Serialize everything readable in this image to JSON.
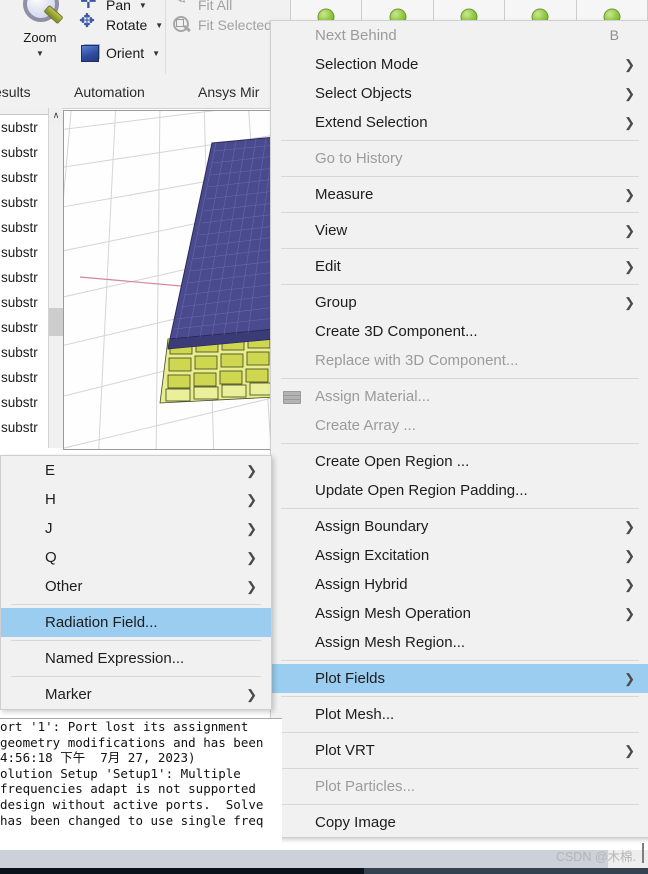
{
  "app": {
    "toolbar": {
      "zoom_label": "Zoom",
      "pan_label": "Pan",
      "rotate_label": "Rotate",
      "orient_label": "Orient",
      "fit_all_label": "Fit All",
      "fit_selected_label": "Fit Selected"
    },
    "ribbon_tabs": [
      {
        "label": "esults"
      },
      {
        "label": "Automation"
      },
      {
        "label": "Ansys Mir"
      }
    ],
    "status_cells": [
      {
        "icon": "green-circle-icon"
      },
      {
        "icon": "green-circle-icon"
      },
      {
        "icon": "green-circle-icon"
      },
      {
        "icon": "green-circle-icon"
      },
      {
        "icon": "green-circle-icon"
      }
    ]
  },
  "tree": {
    "rows": [
      {
        "label": "substr"
      },
      {
        "label": "substr"
      },
      {
        "label": "substr"
      },
      {
        "label": "substr"
      },
      {
        "label": "substr"
      },
      {
        "label": "substr"
      },
      {
        "label": "substr"
      },
      {
        "label": "substr"
      },
      {
        "label": "substr"
      },
      {
        "label": "substr"
      },
      {
        "label": "substr"
      },
      {
        "label": "substr"
      },
      {
        "label": "substr"
      }
    ],
    "scroll_up_glyph": "∧"
  },
  "log": {
    "lines": [
      "ort '1': Port lost its assignment",
      "geometry modifications and has been",
      "4:56:18 下午  7月 27, 2023)",
      "olution Setup 'Setup1': Multiple",
      "frequencies adapt is not supported",
      "design without active ports.  Solve",
      "has been changed to use single freq"
    ]
  },
  "context_menu": {
    "items": [
      {
        "label": "Next Behind",
        "accel": "B",
        "arrow": false,
        "disabled": true,
        "selected": false,
        "sep_after": false
      },
      {
        "label": "Selection Mode",
        "accel": "",
        "arrow": true,
        "disabled": false,
        "selected": false,
        "sep_after": false
      },
      {
        "label": "Select Objects",
        "accel": "",
        "arrow": true,
        "disabled": false,
        "selected": false,
        "sep_after": false
      },
      {
        "label": "Extend Selection",
        "accel": "",
        "arrow": true,
        "disabled": false,
        "selected": false,
        "sep_after": true
      },
      {
        "label": "Go to History",
        "accel": "",
        "arrow": false,
        "disabled": true,
        "selected": false,
        "sep_after": true
      },
      {
        "label": "Measure",
        "accel": "",
        "arrow": true,
        "disabled": false,
        "selected": false,
        "sep_after": true
      },
      {
        "label": "View",
        "accel": "",
        "arrow": true,
        "disabled": false,
        "selected": false,
        "sep_after": true
      },
      {
        "label": "Edit",
        "accel": "",
        "arrow": true,
        "disabled": false,
        "selected": false,
        "sep_after": true
      },
      {
        "label": "Group",
        "accel": "",
        "arrow": true,
        "disabled": false,
        "selected": false,
        "sep_after": false
      },
      {
        "label": "Create 3D Component...",
        "accel": "",
        "arrow": false,
        "disabled": false,
        "selected": false,
        "sep_after": false
      },
      {
        "label": "Replace with 3D Component...",
        "accel": "",
        "arrow": false,
        "disabled": true,
        "selected": false,
        "sep_after": true
      },
      {
        "label": "Assign Material...",
        "accel": "",
        "arrow": false,
        "disabled": true,
        "selected": false,
        "sep_after": false,
        "icon": "material-stack-icon"
      },
      {
        "label": "Create Array ...",
        "accel": "",
        "arrow": false,
        "disabled": true,
        "selected": false,
        "sep_after": true
      },
      {
        "label": "Create Open Region ...",
        "accel": "",
        "arrow": false,
        "disabled": false,
        "selected": false,
        "sep_after": false
      },
      {
        "label": "Update Open Region Padding...",
        "accel": "",
        "arrow": false,
        "disabled": false,
        "selected": false,
        "sep_after": true
      },
      {
        "label": "Assign Boundary",
        "accel": "",
        "arrow": true,
        "disabled": false,
        "selected": false,
        "sep_after": false
      },
      {
        "label": "Assign Excitation",
        "accel": "",
        "arrow": true,
        "disabled": false,
        "selected": false,
        "sep_after": false
      },
      {
        "label": "Assign Hybrid",
        "accel": "",
        "arrow": true,
        "disabled": false,
        "selected": false,
        "sep_after": false
      },
      {
        "label": "Assign Mesh Operation",
        "accel": "",
        "arrow": true,
        "disabled": false,
        "selected": false,
        "sep_after": false
      },
      {
        "label": "Assign Mesh Region...",
        "accel": "",
        "arrow": false,
        "disabled": false,
        "selected": false,
        "sep_after": true
      },
      {
        "label": "Plot Fields",
        "accel": "",
        "arrow": true,
        "disabled": false,
        "selected": true,
        "sep_after": true
      },
      {
        "label": "Plot Mesh...",
        "accel": "",
        "arrow": false,
        "disabled": false,
        "selected": false,
        "sep_after": true
      },
      {
        "label": "Plot VRT",
        "accel": "",
        "arrow": true,
        "disabled": false,
        "selected": false,
        "sep_after": true
      },
      {
        "label": "Plot Particles...",
        "accel": "",
        "arrow": false,
        "disabled": true,
        "selected": false,
        "sep_after": true
      },
      {
        "label": "Copy Image",
        "accel": "",
        "arrow": false,
        "disabled": false,
        "selected": false,
        "sep_after": false
      }
    ]
  },
  "submenu": {
    "items": [
      {
        "label": "E",
        "arrow": true,
        "selected": false,
        "sep_after": false
      },
      {
        "label": "H",
        "arrow": true,
        "selected": false,
        "sep_after": false
      },
      {
        "label": "J",
        "arrow": true,
        "selected": false,
        "sep_after": false
      },
      {
        "label": "Q",
        "arrow": true,
        "selected": false,
        "sep_after": false
      },
      {
        "label": "Other",
        "arrow": true,
        "selected": false,
        "sep_after": true
      },
      {
        "label": "Radiation Field...",
        "arrow": false,
        "selected": true,
        "sep_after": true
      },
      {
        "label": "Named Expression...",
        "arrow": false,
        "selected": false,
        "sep_after": true
      },
      {
        "label": "Marker",
        "arrow": true,
        "selected": false,
        "sep_after": false
      }
    ]
  },
  "watermark": {
    "text": "CSDN @木棉."
  },
  "colors": {
    "menu_bg": "#f1f1f1",
    "highlight": "#9acdef",
    "disabled_text": "#9b9b9b",
    "status_green": "#8ec63f",
    "mesh_purple": "#4a4a8f",
    "mesh_yellow": "#cfd54a"
  }
}
